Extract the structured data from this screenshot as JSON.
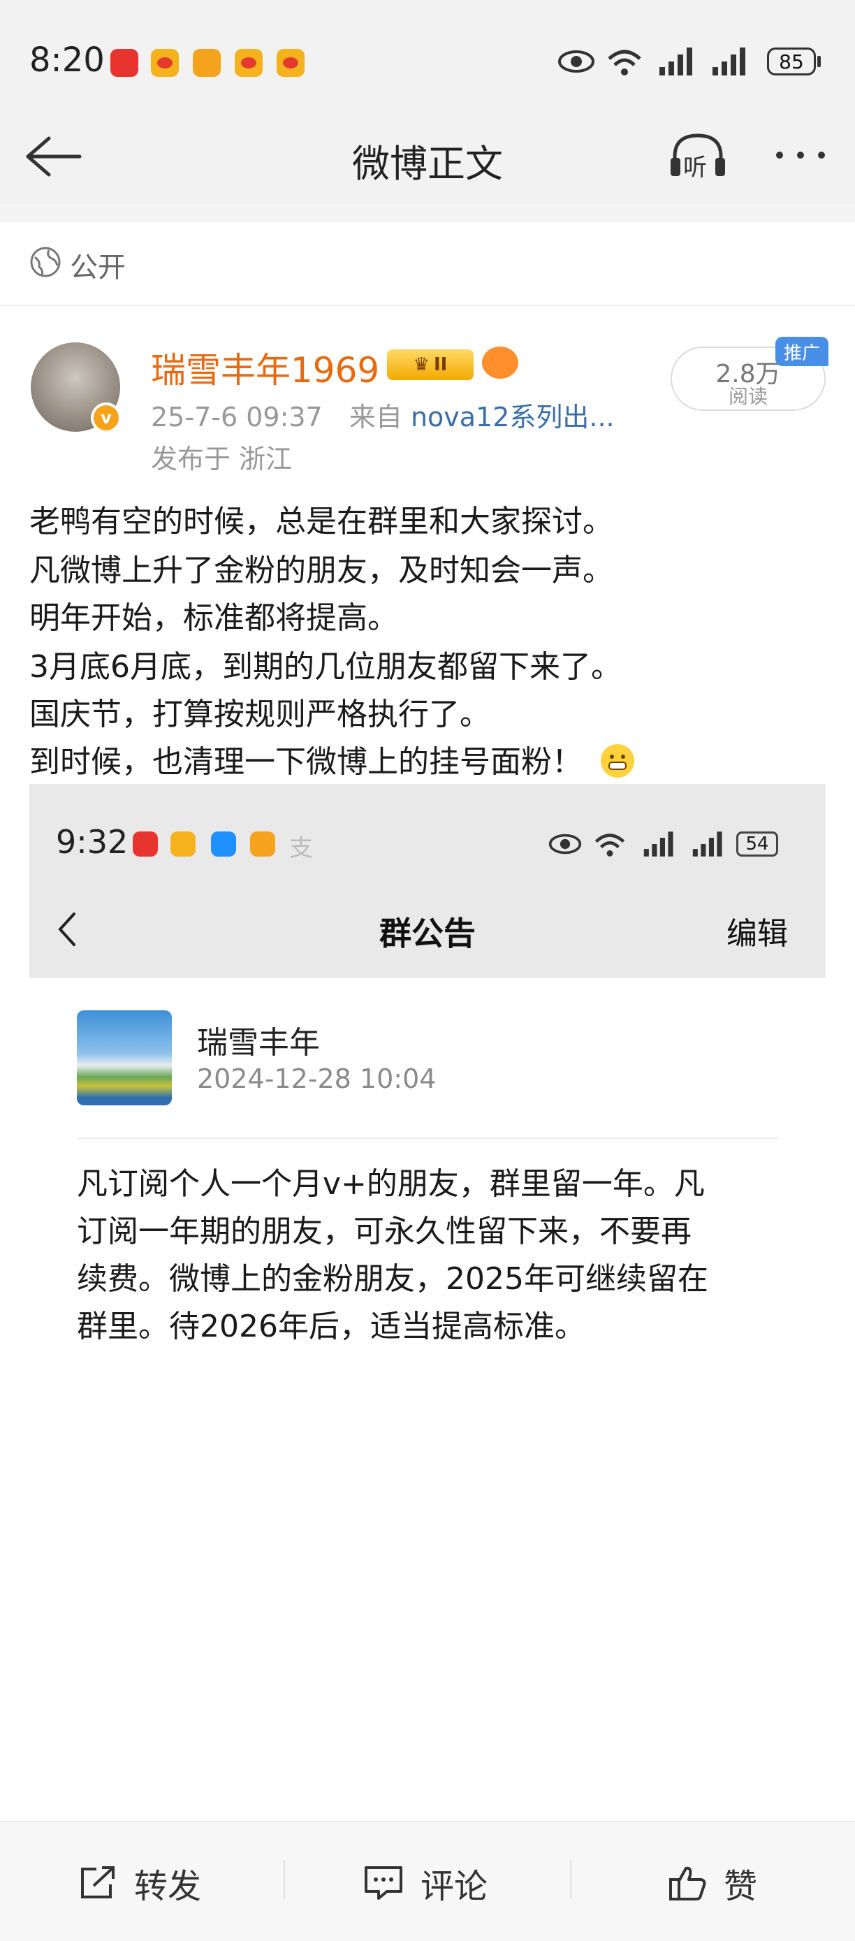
{
  "status_bar": {
    "time": "8:20",
    "battery": "85",
    "icons": [
      "huawei-store-icon",
      "weibo-icon",
      "orange-app-icon",
      "weibo-icon",
      "weibo-icon",
      "eye-icon",
      "wifi-icon",
      "signal-icon",
      "signal-icon"
    ]
  },
  "nav": {
    "title": "微博正文",
    "back_icon": "back-arrow-icon",
    "listen_label": "听",
    "more_icon": "more-icon"
  },
  "visibility": {
    "label": "公开",
    "icon": "globe-icon"
  },
  "post": {
    "author": "瑞雪丰年1969",
    "verified_badge": "v",
    "level_badge": "II",
    "date": "25-7-6 09:37",
    "source_prefix": "来自",
    "source": "nova12系列出...",
    "location": "发布于 浙江",
    "reads_count": "2.8万",
    "reads_label": "阅读",
    "promo_tag": "推广",
    "lines": [
      "老鸭有空的时候，总是在群里和大家探讨。",
      "凡微博上升了金粉的朋友，及时知会一声。",
      "明年开始，标准都将提高。",
      "3月底6月底，到期的几位朋友都留下来了。",
      "国庆节，打算按规则严格执行了。",
      "到时候，也清理一下微博上的挂号面粉！"
    ]
  },
  "embedded": {
    "status_time": "9:32",
    "battery": "54",
    "title": "群公告",
    "edit": "编辑",
    "group_name": "瑞雪丰年",
    "group_date": "2024-12-28 10:04",
    "notice_lines": [
      "凡订阅个人一个月v+的朋友，群里留一年。凡",
      "订阅一年期的朋友，可永久性留下来，不要再",
      "续费。微博上的金粉朋友，2025年可继续留在",
      "群里。待2026年后，适当提高标准。"
    ]
  },
  "bottom_bar": {
    "repost": "转发",
    "comment": "评论",
    "like": "赞"
  },
  "colors": {
    "author": "#e8690f",
    "source": "#3a6ea8",
    "meta": "#999999",
    "promo": "#4a8fe7"
  }
}
